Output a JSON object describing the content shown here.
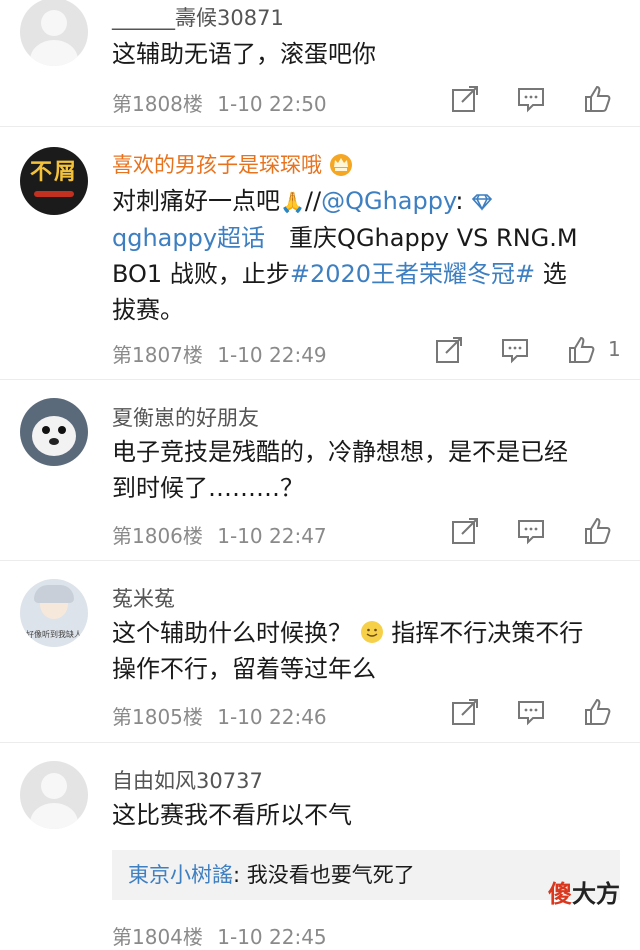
{
  "comments": [
    {
      "user": "______壽候30871",
      "text": "这辅助无语了，滚蛋吧你",
      "floor": "第1808楼",
      "time": "1-10 22:50",
      "likes": ""
    },
    {
      "user": "喜欢的男孩子是琛琛哦",
      "line1_prefix": "对刺痛好一点吧",
      "line1_mid": "//",
      "line1_mention": "@QGhappy",
      "line1_colon": ":",
      "line2_topic": "qghappy超话",
      "line2_rest": "　重庆QGhappy VS RNG.M",
      "line3_prefix": "BO1 战败，止步",
      "line3_tag": "#2020王者荣耀冬冠#",
      "line3_suffix": " 选",
      "line4": "拔赛。",
      "floor": "第1807楼",
      "time": "1-10 22:49",
      "likes": "1"
    },
    {
      "user": "夏衡崽的好朋友",
      "line1": "电子竞技是残酷的，冷静想想，是不是已经",
      "line2": "到时候了………？",
      "floor": "第1806楼",
      "time": "1-10 22:47",
      "likes": ""
    },
    {
      "user": "菟米菟",
      "line1_prefix": "这个辅助什么时候换？",
      "line1_suffix": "指挥不行决策不行",
      "line2": "操作不行，留着等过年么",
      "avatar_caption": "好像听到我缺人",
      "floor": "第1805楼",
      "time": "1-10 22:46",
      "likes": ""
    },
    {
      "user": "自由如风30737",
      "text": "这比赛我不看所以不气",
      "reply_user": "東京小树謠",
      "reply_sep": ": ",
      "reply_text": "我没看也要气死了",
      "floor": "第1804楼",
      "time": "1-10 22:45"
    }
  ],
  "avatar_2_caption": "不屑",
  "watermark": {
    "accent": "傻",
    "rest": "大方"
  },
  "colors": {
    "link": "#3d7fc1",
    "vip_name": "#e8731f",
    "meta": "#8a8a8a"
  },
  "icons": [
    "share-icon",
    "comment-icon",
    "like-icon",
    "crown-icon",
    "emoji-smile-icon",
    "diamond-icon"
  ]
}
